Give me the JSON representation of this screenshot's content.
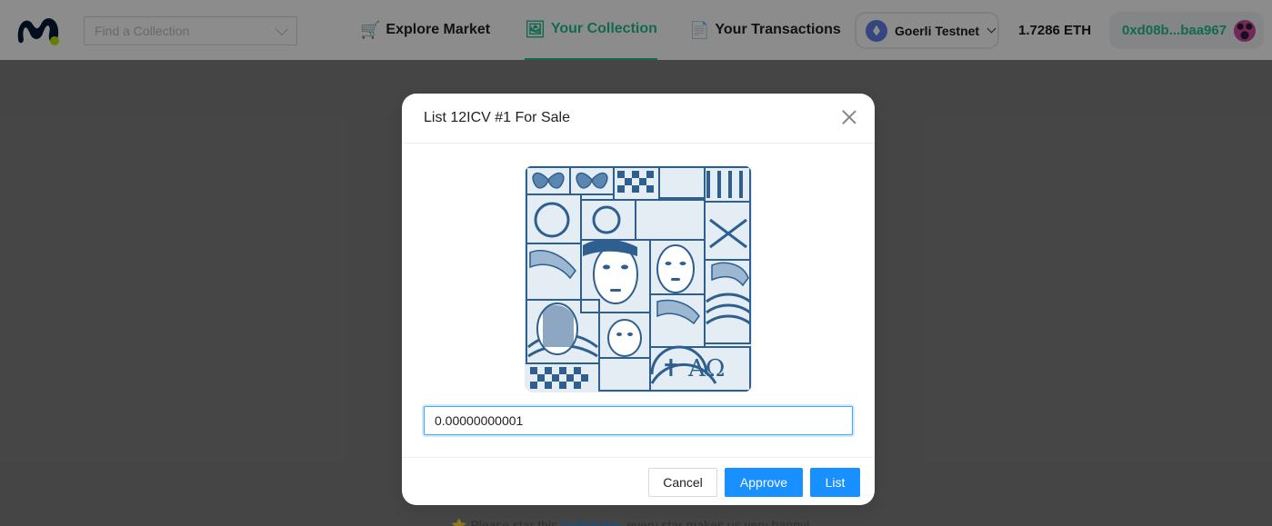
{
  "header": {
    "search": {
      "placeholder": "Find a Collection"
    },
    "nav": [
      {
        "icon": "🛒",
        "label": "Explore Market"
      },
      {
        "icon": "🖼",
        "label": "Your Collection"
      },
      {
        "icon": "📄",
        "label": "Your Transactions"
      }
    ],
    "network": {
      "label": "Goerli Testnet"
    },
    "balance": "1.7286 ETH",
    "account": "0xd08b...baa967"
  },
  "footer_note": {
    "prefix": "⭐ Please star this ",
    "link": "boilerplate",
    "suffix": ", every star makes us very happy!"
  },
  "modal": {
    "title": "List 12ICV #1 For Sale",
    "price_value": "0.00000000001",
    "cancel_label": "Cancel",
    "approve_label": "Approve",
    "list_label": "List",
    "art_symbols": "✝ ΑΩ"
  },
  "colors": {
    "accent": "#21bf96",
    "primary": "#1890ff",
    "art_blue": "#2f5f8f"
  }
}
